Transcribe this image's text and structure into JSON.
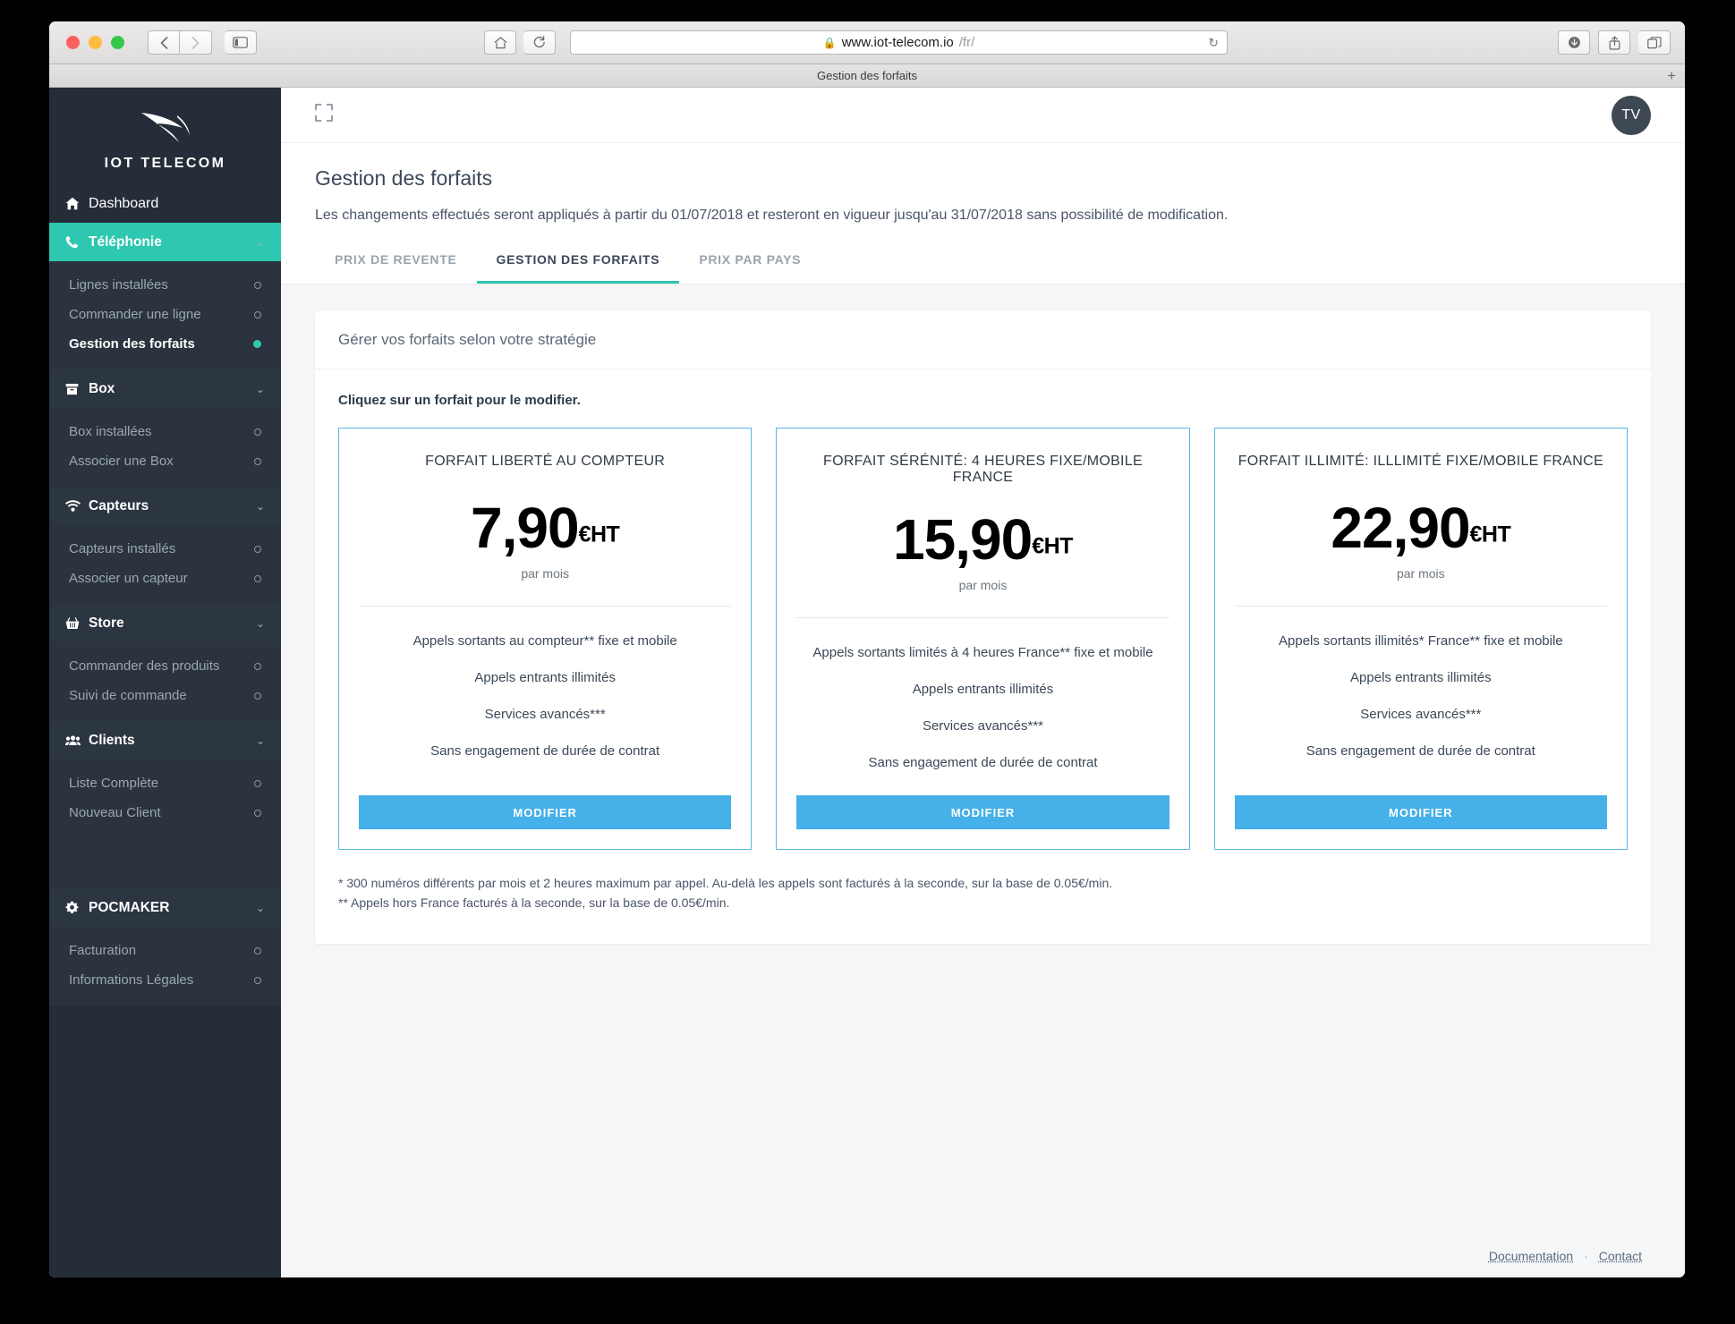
{
  "browser": {
    "tab_title": "Gestion des forfaits",
    "url_lock": "lock-icon",
    "url_host": "www.iot-telecom.io",
    "url_path": "/fr/",
    "new_tab_label": "+"
  },
  "sidebar": {
    "logo_text": "IOT TELECOM",
    "nav": [
      {
        "label": "Dashboard",
        "icon": "home-icon",
        "type": "plain",
        "state": "default"
      },
      {
        "label": "Téléphonie",
        "icon": "phone-icon",
        "type": "section",
        "state": "active",
        "chevron": "⌄"
      },
      {
        "label": "Box",
        "icon": "box-icon",
        "type": "section",
        "state": "default",
        "chevron": "⌄"
      },
      {
        "label": "Capteurs",
        "icon": "wifi-icon",
        "type": "section",
        "state": "default",
        "chevron": "⌄"
      },
      {
        "label": "Store",
        "icon": "basket-icon",
        "type": "section",
        "state": "default",
        "chevron": "⌄"
      },
      {
        "label": "Clients",
        "icon": "users-icon",
        "type": "section",
        "state": "default",
        "chevron": "⌄"
      },
      {
        "label": "POCMAKER",
        "icon": "gear-icon",
        "type": "section",
        "state": "default",
        "chevron": "⌄"
      }
    ],
    "telephonie_items": [
      {
        "label": "Lignes installées",
        "selected": false
      },
      {
        "label": "Commander une ligne",
        "selected": false
      },
      {
        "label": "Gestion des forfaits",
        "selected": true
      }
    ],
    "box_items": [
      {
        "label": "Box installées",
        "selected": false
      },
      {
        "label": "Associer une Box",
        "selected": false
      }
    ],
    "capteurs_items": [
      {
        "label": "Capteurs installés",
        "selected": false
      },
      {
        "label": "Associer un capteur",
        "selected": false
      }
    ],
    "store_items": [
      {
        "label": "Commander des produits",
        "selected": false
      },
      {
        "label": "Suivi de commande",
        "selected": false
      }
    ],
    "clients_items": [
      {
        "label": "Liste Complète",
        "selected": false
      },
      {
        "label": "Nouveau Client",
        "selected": false
      }
    ],
    "pocmaker_items": [
      {
        "label": "Facturation",
        "selected": false
      },
      {
        "label": "Informations Légales",
        "selected": false
      }
    ]
  },
  "topbar": {
    "expand_icon": "expand-icon",
    "avatar_initials": "TV"
  },
  "page": {
    "title": "Gestion des forfaits",
    "subtitle": "Les changements effectués seront appliqués à partir du 01/07/2018 et resteront en vigueur jusqu'au 31/07/2018 sans possibilité de modification.",
    "tabs": [
      {
        "label": "PRIX DE REVENTE",
        "active": false
      },
      {
        "label": "GESTION DES FORFAITS",
        "active": true
      },
      {
        "label": "PRIX PAR PAYS",
        "active": false
      }
    ],
    "card_header": "Gérer vos forfaits selon votre stratégie",
    "click_hint": "Cliquez sur un forfait pour le modifier.",
    "plans": [
      {
        "name": "FORFAIT LIBERTÉ AU COMPTEUR",
        "price": "7,90",
        "unit": "€HT",
        "period": "par mois",
        "features": [
          "Appels sortants au compteur** fixe et mobile",
          "Appels entrants illimités",
          "Services avancés***",
          "Sans engagement de durée de contrat"
        ],
        "button": "MODIFIER"
      },
      {
        "name": "FORFAIT SÉRÉNITÉ: 4 HEURES FIXE/MOBILE FRANCE",
        "price": "15,90",
        "unit": "€HT",
        "period": "par mois",
        "features": [
          "Appels sortants limités à 4 heures France** fixe et mobile",
          "Appels entrants illimités",
          "Services avancés***",
          "Sans engagement de durée de contrat"
        ],
        "button": "MODIFIER"
      },
      {
        "name": "FORFAIT ILLIMITÉ: ILLLIMITÉ FIXE/MOBILE FRANCE",
        "price": "22,90",
        "unit": "€HT",
        "period": "par mois",
        "features": [
          "Appels sortants illimités* France** fixe et mobile",
          "Appels entrants illimités",
          "Services avancés***",
          "Sans engagement de durée de contrat"
        ],
        "button": "MODIFIER"
      }
    ],
    "footnotes": [
      "* 300 numéros différents par mois et 2 heures maximum par appel. Au-delà les appels sont facturés à la seconde, sur la base de 0.05€/min.",
      "** Appels hors France facturés à la seconde, sur la base de 0.05€/min."
    ],
    "footer": {
      "documentation": "Documentation",
      "separator": "·",
      "contact": "Contact"
    }
  },
  "colors": {
    "accent_teal": "#2ec7b0",
    "accent_blue": "#46b0e8",
    "sidebar_bg": "#252e38",
    "card_border": "#5bb7e8"
  }
}
